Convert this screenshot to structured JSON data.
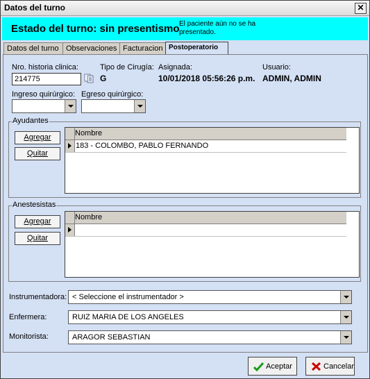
{
  "window": {
    "title": "Datos del turno",
    "close_glyph": "✕"
  },
  "status": {
    "title": "Estado del turno: sin presentismo",
    "message": "El paciente aún no se ha presentado."
  },
  "tabs": [
    {
      "label": "Datos del turno"
    },
    {
      "label": "Observaciones"
    },
    {
      "label": "Facturacion"
    },
    {
      "label": "Postoperatorio",
      "active": true
    }
  ],
  "form": {
    "historia_label": "Nro. historia clinica:",
    "historia_value": "214775",
    "tipo_label": "Tipo de Cirugía:",
    "tipo_value": "G",
    "asignada_label": "Asignada:",
    "asignada_value": "10/01/2018 05:56:26 p.m.",
    "usuario_label": "Usuario:",
    "usuario_value": "ADMIN, ADMIN",
    "ingreso_label": "Ingreso quirúrgico:",
    "ingreso_value": "",
    "egreso_label": "Egreso quirúrgico:",
    "egreso_value": ""
  },
  "ayudantes": {
    "title": "Ayudantes",
    "add_label": "Agregar",
    "remove_label": "Quitar",
    "column": "Nombre",
    "rows": [
      "183 - COLOMBO, PABLO FERNANDO"
    ]
  },
  "anestesistas": {
    "title": "Anestesistas",
    "add_label": "Agregar",
    "remove_label": "Quitar",
    "column": "Nombre",
    "rows": [
      ""
    ]
  },
  "staff": {
    "instrumentadora_label": "Instrumentadora:",
    "instrumentadora_value": "< Seleccione el instrumentador >",
    "enfermera_label": "Enfermera:",
    "enfermera_value": "RUIZ MARIA DE LOS ANGELES",
    "monitorista_label": "Monitorista:",
    "monitorista_value": "ARAGOR SEBASTIAN"
  },
  "footer": {
    "accept_label": "Aceptar",
    "cancel_label": "Cancelar"
  },
  "colors": {
    "banner": "#00ffff",
    "accept_icon": "#1a9a1a",
    "cancel_icon": "#cc0000"
  }
}
